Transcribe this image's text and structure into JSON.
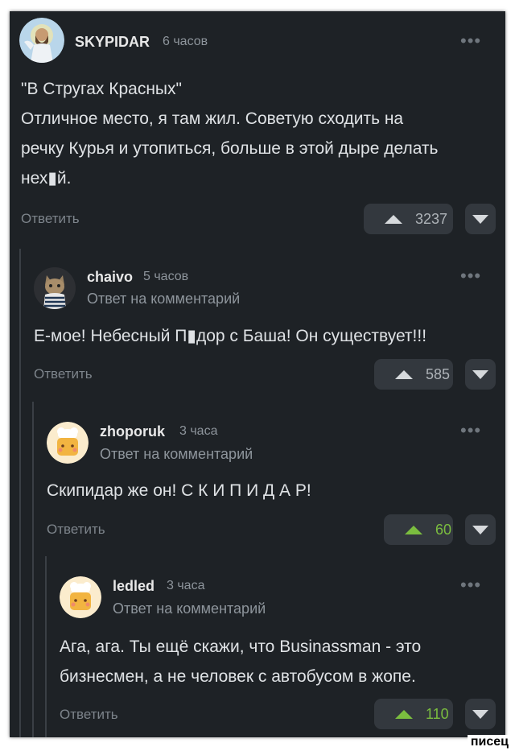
{
  "comments": [
    {
      "username": "SKYPIDAR",
      "time": "6 часов",
      "reply_to": "",
      "text": "\"В Стругах Красных\"\nОтличное место, я там жил. Советую сходить на\nречку Курья и утопиться, больше в этой дыре делать\nнех▮й.",
      "reply_label": "Ответить",
      "votes": "3237",
      "avatar": "saint-avatar"
    },
    {
      "username": "chaivo",
      "time": "5 часов",
      "reply_to": "Ответ на комментарий",
      "text": "Е-мое! Небесный П▮дор с Баша! Он существует!!!",
      "reply_label": "Ответить",
      "votes": "585",
      "avatar": "cat-avatar"
    },
    {
      "username": "zhoporuk",
      "time": "3 часа",
      "reply_to": "Ответ на комментарий",
      "text": "Скипидар же он! С К И П И Д А Р!",
      "reply_label": "Ответить",
      "votes": "60",
      "avatar": "chef-avatar"
    },
    {
      "username": "ledled",
      "time": "3 часа",
      "reply_to": "Ответ на комментарий",
      "text": "Ага, ага. Ты ещё скажи, что Businassman - это\nбизнесмен, а не человек с автобусом в жопе.",
      "reply_label": "Ответить",
      "votes": "110",
      "avatar": "chef-avatar"
    }
  ],
  "more_icon": "more-dots-icon",
  "upvote_icon": "upvote-triangle-icon",
  "downvote_icon": "downvote-triangle-icon",
  "colors": {
    "background": "#1e2226",
    "green": "#7bbd3f",
    "button": "#33383e"
  },
  "watermark": "писец"
}
